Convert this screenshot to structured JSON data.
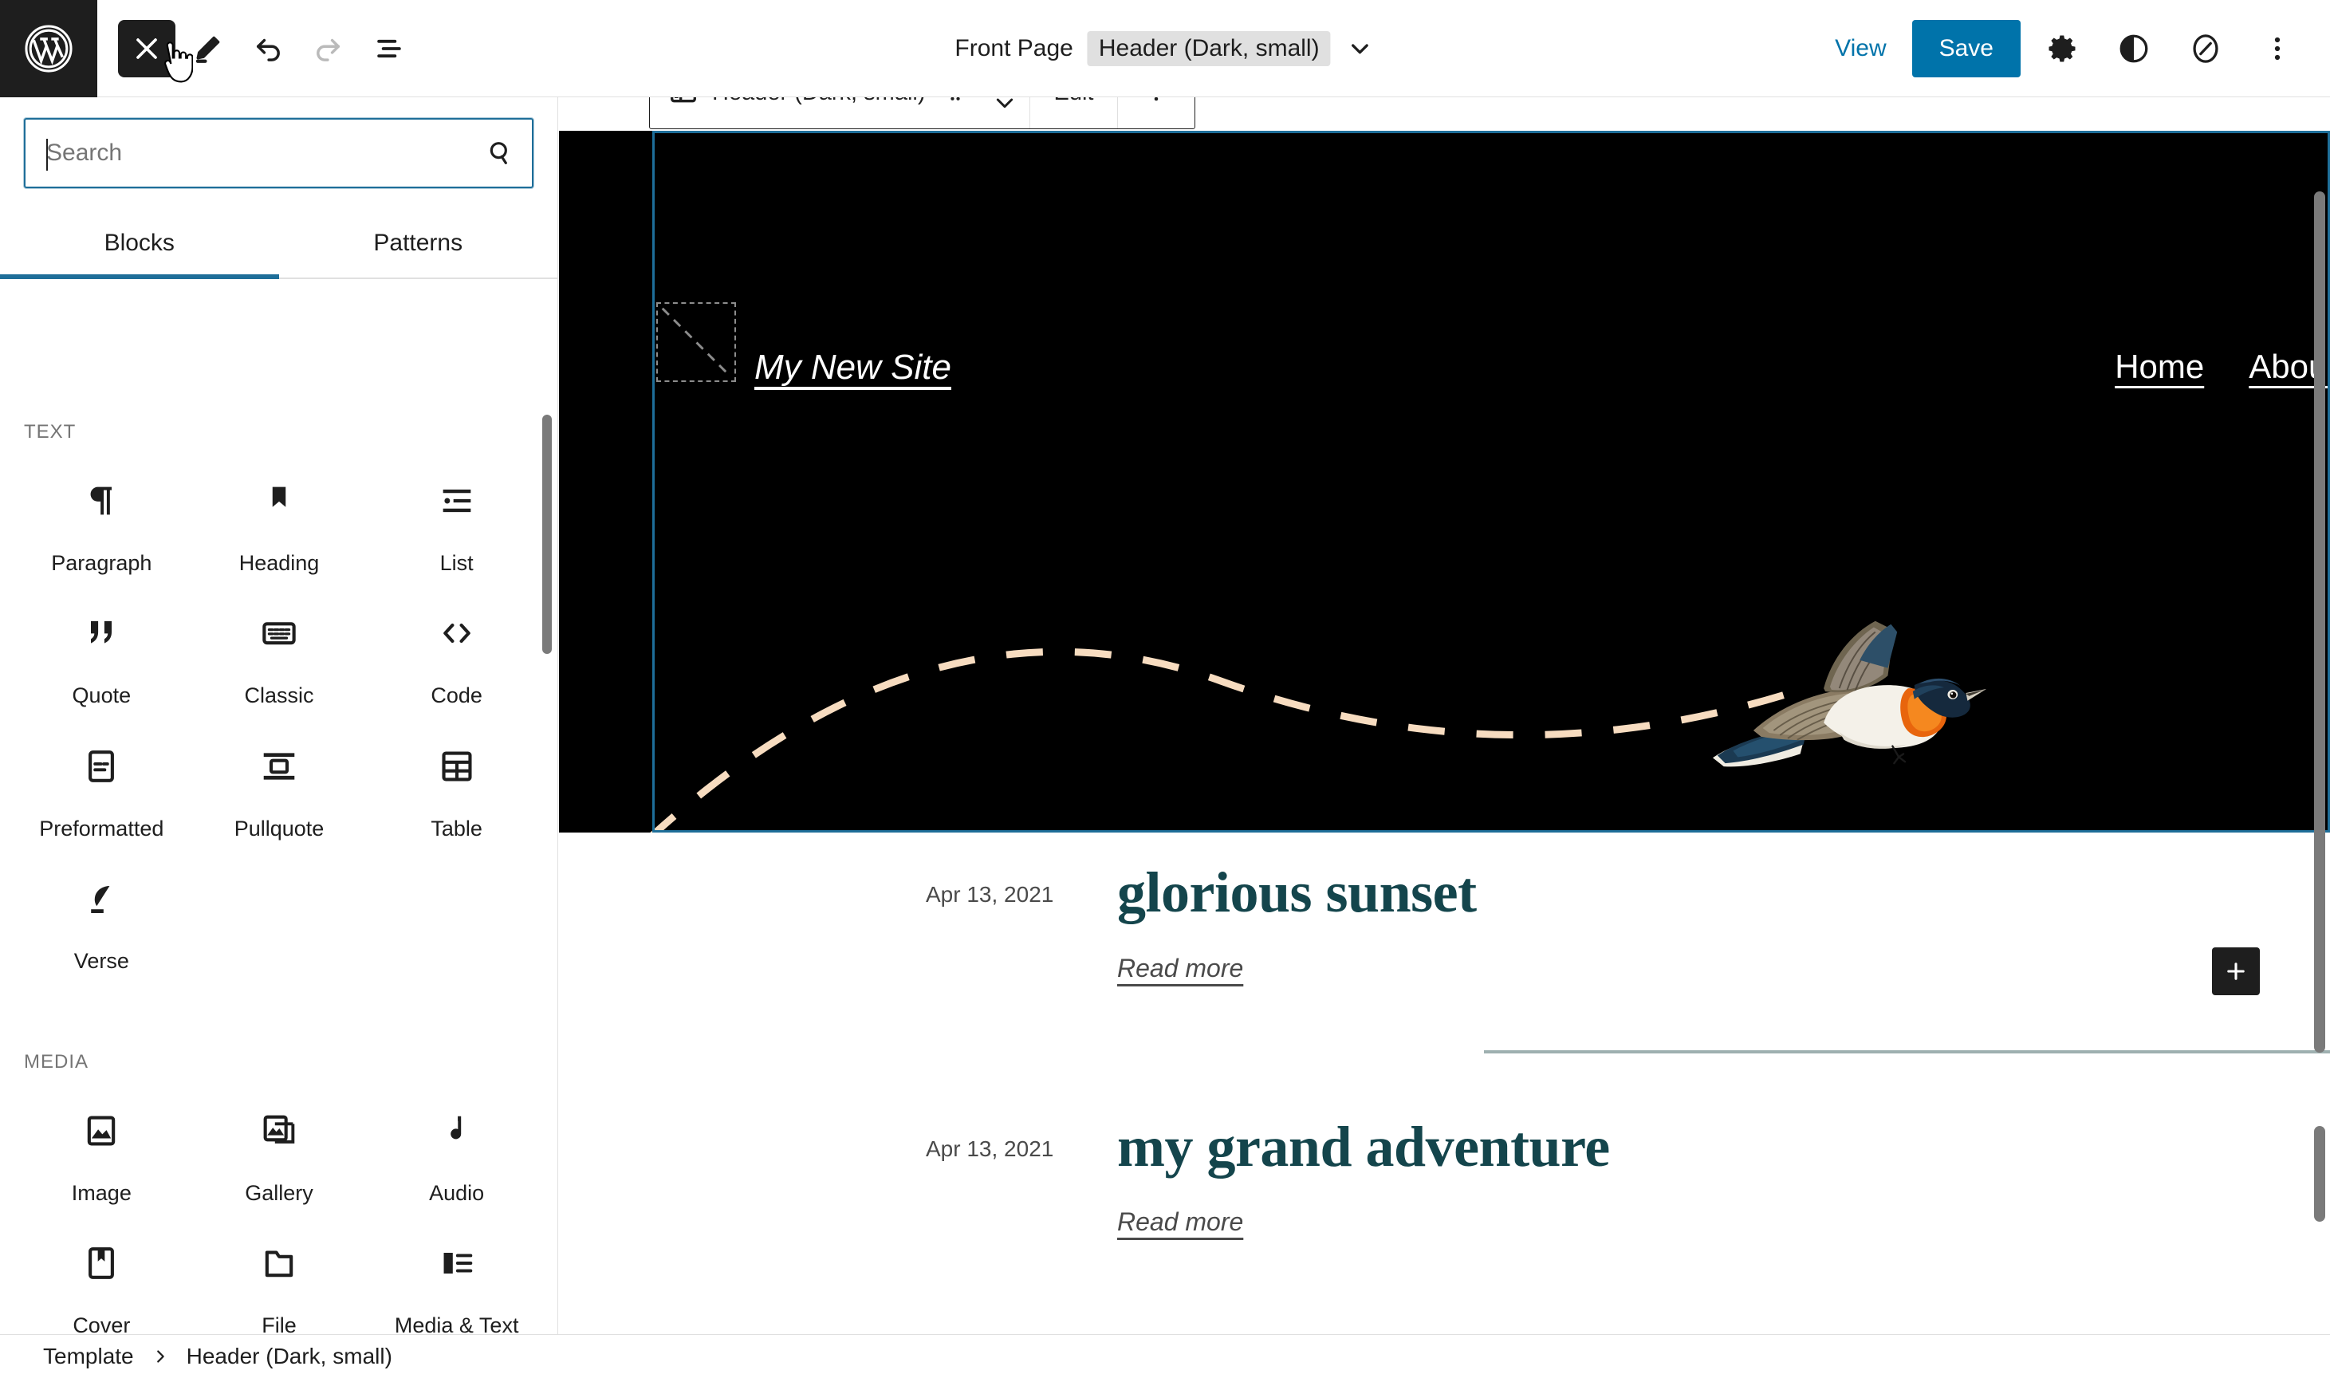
{
  "topbar": {
    "logo_icon": "wordpress-logo-icon",
    "close_label": "Close block inserter",
    "close_icon": "close-x-icon",
    "tools_icon": "pencil-edit-icon",
    "undo_icon": "undo-arrow-icon",
    "redo_icon": "redo-arrow-icon",
    "list_view_icon": "list-view-icon",
    "document_prefix": "Front Page",
    "document_chip": "Header (Dark, small)",
    "chevron_icon": "chevron-down-icon",
    "view_label": "View",
    "save_label": "Save",
    "settings_icon": "gear-icon",
    "styles_icon": "contrast-half-circle-icon",
    "navigation_icon": "compass-circle-icon",
    "options_icon": "three-dots-vertical-icon",
    "accent_color": "#0073aa",
    "dark_color": "#1e1e1e"
  },
  "inserter": {
    "search": {
      "value": "",
      "placeholder": "Search",
      "icon": "search-magnifier-icon"
    },
    "tabs": [
      {
        "label": "Blocks",
        "active": true
      },
      {
        "label": "Patterns",
        "active": false
      }
    ],
    "categories": [
      {
        "label": "TEXT",
        "blocks": [
          {
            "name": "Paragraph",
            "icon": "paragraph-pilcrow-icon"
          },
          {
            "name": "Heading",
            "icon": "heading-bookmark-icon"
          },
          {
            "name": "List",
            "icon": "list-bullet-icon"
          },
          {
            "name": "Quote",
            "icon": "quote-marks-icon"
          },
          {
            "name": "Classic",
            "icon": "classic-keyboard-icon"
          },
          {
            "name": "Code",
            "icon": "code-angle-brackets-icon"
          },
          {
            "name": "Preformatted",
            "icon": "preformatted-page-icon"
          },
          {
            "name": "Pullquote",
            "icon": "pullquote-bars-icon"
          },
          {
            "name": "Table",
            "icon": "table-grid-icon"
          },
          {
            "name": "Verse",
            "icon": "verse-feather-icon"
          }
        ]
      },
      {
        "label": "MEDIA",
        "blocks": [
          {
            "name": "Image",
            "icon": "image-picture-icon"
          },
          {
            "name": "Gallery",
            "icon": "gallery-stacked-images-icon"
          },
          {
            "name": "Audio",
            "icon": "audio-music-note-icon"
          },
          {
            "name": "Cover",
            "icon": "cover-bookmark-page-icon"
          },
          {
            "name": "File",
            "icon": "file-folder-icon"
          },
          {
            "name": "Media & Text",
            "icon": "media-and-text-icon"
          }
        ]
      }
    ]
  },
  "canvas": {
    "block_toolbar": {
      "block_icon": "template-part-layout-icon",
      "block_label": "Header (Dark, small)",
      "drag_icon": "drag-handle-dots-icon",
      "move_up_icon": "chevron-up-icon",
      "move_down_icon": "chevron-down-icon",
      "edit_label": "Edit",
      "more_icon": "three-dots-vertical-icon"
    },
    "site_header": {
      "logo_placeholder_icon": "image-placeholder-dashed-icon",
      "site_title": "My New Site",
      "nav_links": [
        "Home",
        "About"
      ],
      "background_color": "#000000",
      "decoration": "dashed-arc-with-flying-bird",
      "arc_color": "#f7dcc0",
      "appender_icon": "plus-icon",
      "selection_color": "#1e6e99"
    },
    "posts": [
      {
        "date": "Apr 13, 2021",
        "title": "glorious sunset",
        "read_more": "Read more"
      },
      {
        "date": "Apr 13, 2021",
        "title": "my grand adventure",
        "read_more": "Read more"
      }
    ],
    "post_title_color": "#14454c"
  },
  "footer": {
    "breadcrumbs": [
      "Template",
      "Header (Dark, small)"
    ],
    "separator_icon": "chevron-right-icon"
  }
}
